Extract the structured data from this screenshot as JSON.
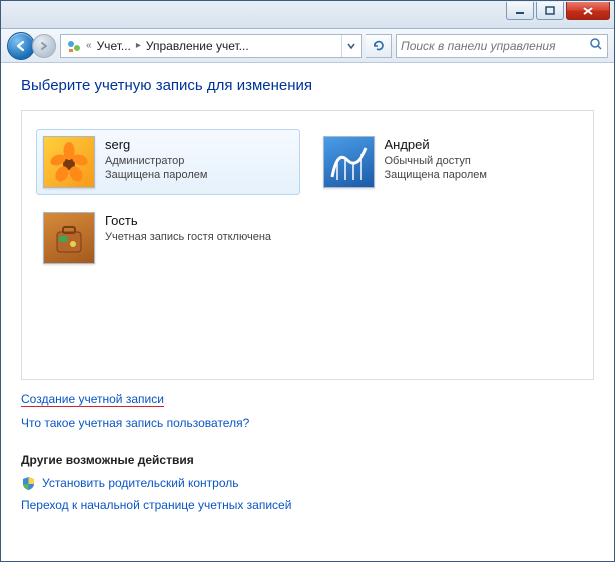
{
  "breadcrumb": {
    "chevrons": "«",
    "part1": "Учет...",
    "sep": "▸",
    "part2": "Управление учет..."
  },
  "search": {
    "placeholder": "Поиск в панели управления"
  },
  "page": {
    "title": "Выберите учетную запись для изменения"
  },
  "accounts": [
    {
      "name": "serg",
      "role": "Администратор",
      "status": "Защищена паролем",
      "avatar": "flower",
      "selected": true
    },
    {
      "name": "Андрей",
      "role": "Обычный доступ",
      "status": "Защищена паролем",
      "avatar": "coaster",
      "selected": false
    },
    {
      "name": "Гость",
      "role": "Учетная запись гостя отключена",
      "status": "",
      "avatar": "suitcase",
      "selected": false
    }
  ],
  "links": {
    "create": "Создание учетной записи",
    "what_is": "Что такое учетная запись пользователя?",
    "other_heading": "Другие возможные действия",
    "parental": "Установить родительский контроль",
    "goto_main": "Переход к начальной странице учетных записей"
  }
}
